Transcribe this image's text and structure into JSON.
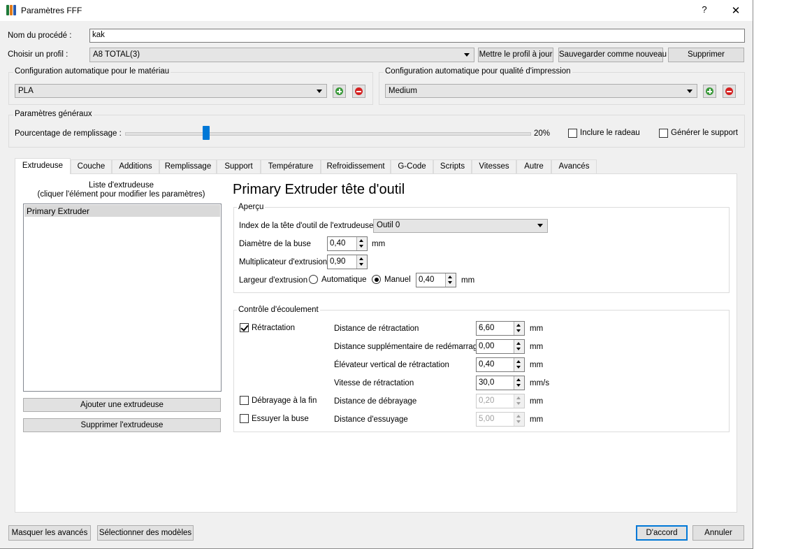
{
  "window": {
    "title": "Paramètres FFF",
    "help": "?",
    "close": "✕"
  },
  "process": {
    "name_label": "Nom du procédé :",
    "name_value": "kak"
  },
  "profile": {
    "label": "Choisir un profil :",
    "value": "A8 TOTAL(3)",
    "update_btn": "Mettre le profil à jour",
    "save_new_btn": "Sauvegarder comme nouveau",
    "delete_btn": "Supprimer"
  },
  "material": {
    "title": "Configuration automatique pour le matériau",
    "value": "PLA"
  },
  "quality": {
    "title": "Configuration automatique pour qualité d'impression",
    "value": "Medium"
  },
  "general": {
    "title": "Paramètres généraux",
    "fill_label": "Pourcentage de remplissage :",
    "fill_value": "20%",
    "fill_fraction": 0.2,
    "raft_label": "Inclure le radeau",
    "support_label": "Générer le support"
  },
  "tabs": [
    "Extrudeuse",
    "Couche",
    "Additions",
    "Remplissage",
    "Support",
    "Température",
    "Refroidissement",
    "G-Code",
    "Scripts",
    "Vitesses",
    "Autre",
    "Avancés"
  ],
  "extruder_list": {
    "header_line1": "Liste d'extrudeuse",
    "header_line2": "(cliquer l'élément pour modifier les paramètres)",
    "items": [
      "Primary Extruder"
    ],
    "add_btn": "Ajouter une extrudeuse",
    "remove_btn": "Supprimer l'extrudeuse"
  },
  "extruder": {
    "heading": "Primary Extruder tête d'outil",
    "overview": {
      "title": "Aperçu",
      "index_label": "Index de la tête d'outil de l'extrudeuse",
      "index_value": "Outil 0",
      "nozzle_label": "Diamètre de la buse",
      "nozzle_value": "0,40",
      "nozzle_unit": "mm",
      "mult_label": "Multiplicateur d'extrusion",
      "mult_value": "0,90",
      "width_label": "Largeur d'extrusion",
      "auto_label": "Automatique",
      "manual_label": "Manuel",
      "width_value": "0,40",
      "width_unit": "mm"
    },
    "flow": {
      "title": "Contrôle d'écoulement",
      "retraction_label": "Rétractation",
      "coast_label": "Débrayage à la fin",
      "wipe_label": "Essuyer la buse",
      "rows": [
        {
          "label": "Distance de rétractation",
          "value": "6,60",
          "unit": "mm"
        },
        {
          "label": "Distance supplémentaire de redémarrage",
          "value": "0,00",
          "unit": "mm"
        },
        {
          "label": "Élévateur vertical de rétractation",
          "value": "0,40",
          "unit": "mm"
        },
        {
          "label": "Vitesse de rétractation",
          "value": "30,0",
          "unit": "mm/s"
        },
        {
          "label": "Distance de débrayage",
          "value": "0,20",
          "unit": "mm"
        },
        {
          "label": "Distance d'essuyage",
          "value": "5,00",
          "unit": "mm"
        }
      ]
    }
  },
  "footer": {
    "hide_advanced": "Masquer les avancés",
    "select_models": "Sélectionner des modèles",
    "ok": "D'accord",
    "cancel": "Annuler"
  },
  "colors": {
    "accent": "#0078d7",
    "plus": "#3a9a3a",
    "minus": "#d42020"
  }
}
